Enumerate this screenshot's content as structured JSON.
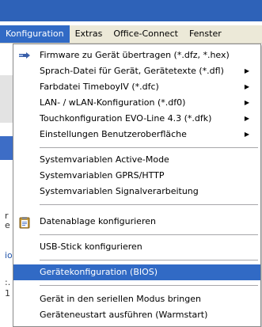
{
  "menubar": {
    "items": [
      {
        "label": "Konfiguration"
      },
      {
        "label": "Extras"
      },
      {
        "label": "Office-Connect"
      },
      {
        "label": "Fenster"
      }
    ]
  },
  "dropdown": {
    "items": [
      {
        "label": "Firmware zu Gerät übertragen (*.dfz, *.hex)",
        "icon": "firmware-transfer-icon"
      },
      {
        "label": "Sprach-Datei für Gerät, Gerätetexte (*.dfl)",
        "submenu": "▶"
      },
      {
        "label": "Farbdatei TimeboyIV (*.dfc)",
        "submenu": "▶"
      },
      {
        "label": "LAN- / wLAN-Konfiguration (*.df0)",
        "submenu": "▶"
      },
      {
        "label": "Touchkonfiguration EVO-Line 4.3 (*.dfk)",
        "submenu": "▶"
      },
      {
        "label": "Einstellungen Benutzeroberfläche",
        "submenu": "▶"
      },
      {
        "label": "Systemvariablen Active-Mode"
      },
      {
        "label": "Systemvariablen GPRS/HTTP"
      },
      {
        "label": "Systemvariablen Signalverarbeitung"
      },
      {
        "label": "Datenablage konfigurieren",
        "icon": "clipboard-icon"
      },
      {
        "label": "USB-Stick konfigurieren"
      },
      {
        "label": "Gerätekonfiguration (BIOS)"
      },
      {
        "label": "Gerät in den seriellen Modus bringen"
      },
      {
        "label": "Geräteneustart ausführen (Warmstart)"
      }
    ]
  },
  "background": {
    "left_chars": [
      "r",
      "e",
      "io",
      ":.",
      "1"
    ]
  },
  "colors": {
    "highlight": "#316ac5",
    "menubar": "#ece9d8",
    "app_header": "#2e62b8"
  }
}
